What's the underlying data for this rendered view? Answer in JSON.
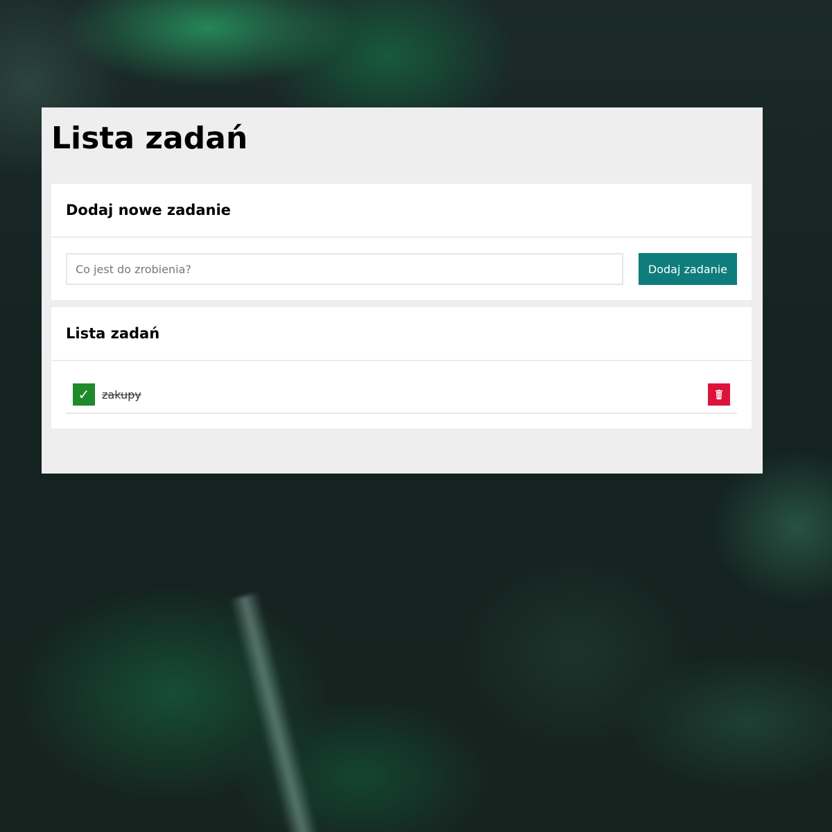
{
  "app": {
    "title": "Lista zadań"
  },
  "add_section": {
    "heading": "Dodaj nowe zadanie",
    "input_placeholder": "Co jest do zrobienia?",
    "input_value": "",
    "button_label": "Dodaj zadanie"
  },
  "list_section": {
    "heading": "Lista zadań",
    "tasks": [
      {
        "text": "zakupy",
        "done": true,
        "check_icon": "check-icon",
        "delete_icon": "trash-icon"
      }
    ]
  },
  "colors": {
    "panel": "#eeeeee",
    "card": "#ffffff",
    "accent": "#0e7d7b",
    "done": "#1f8a2a",
    "delete": "#dc143c"
  }
}
